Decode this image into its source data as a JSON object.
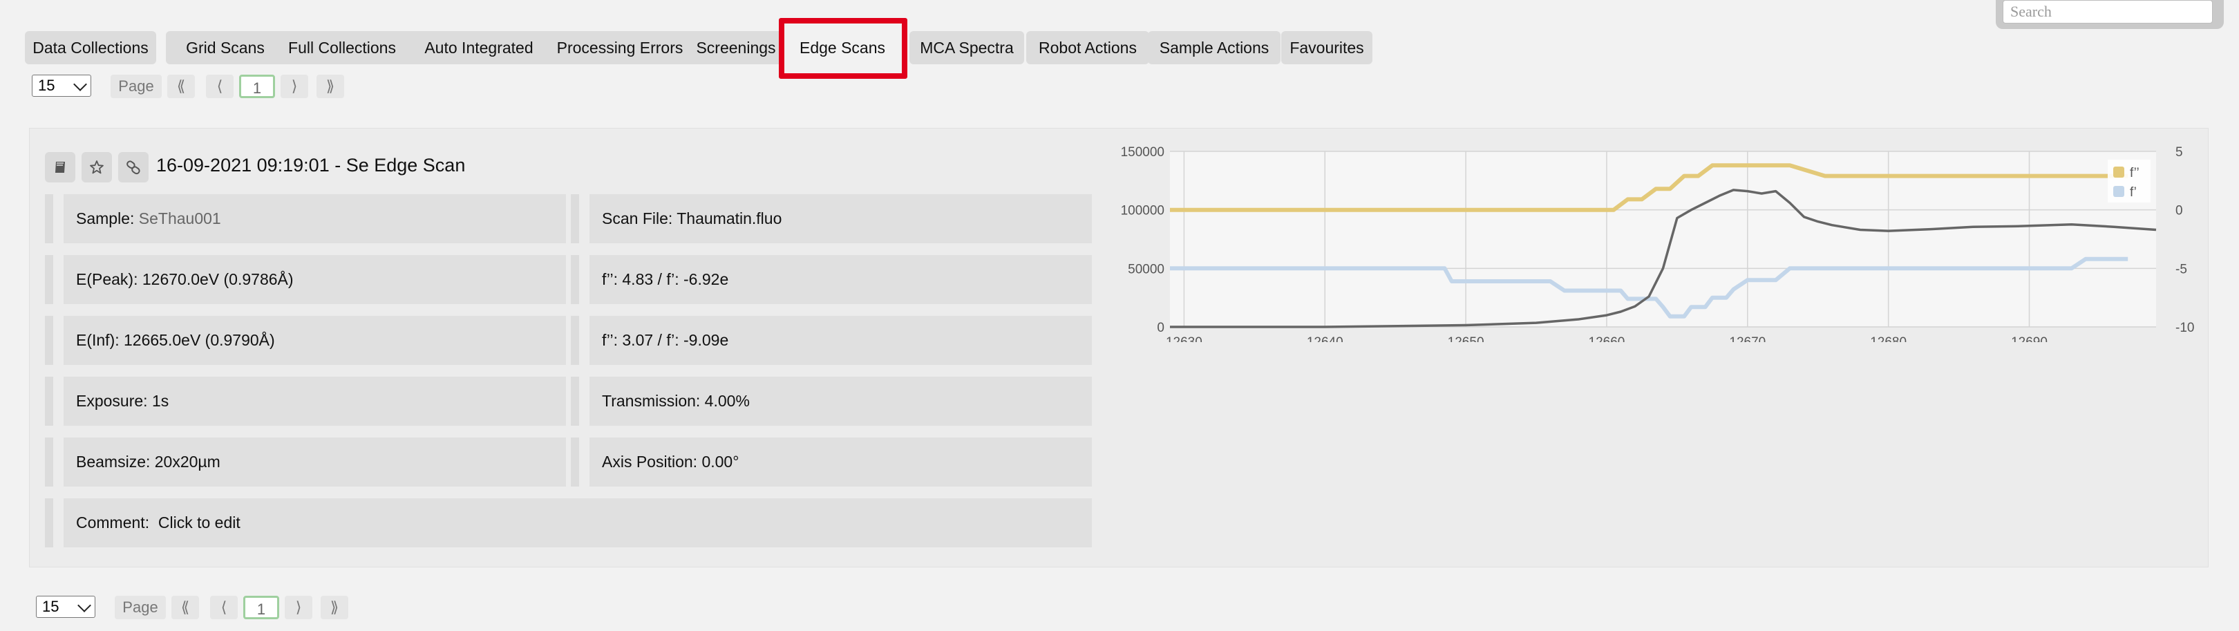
{
  "search": {
    "placeholder": "Search"
  },
  "tabs": [
    {
      "label": "Data Collections"
    },
    {
      "label": "Grid Scans"
    },
    {
      "label": "Full Collections"
    },
    {
      "label": "Auto Integrated"
    },
    {
      "label": "Processing Errors"
    },
    {
      "label": "Screenings"
    },
    {
      "label": "Edge Scans",
      "active": true
    },
    {
      "label": "MCA Spectra"
    },
    {
      "label": "Robot Actions"
    },
    {
      "label": "Sample Actions"
    },
    {
      "label": "Favourites"
    }
  ],
  "pager_top": {
    "per_page": "15",
    "page_label": "Page",
    "first": "⟪",
    "prev": "⟨",
    "current": "1",
    "next": "⟩",
    "last": "⟫"
  },
  "pager_bottom": {
    "per_page": "15",
    "page_label": "Page",
    "first": "⟪",
    "prev": "⟨",
    "current": "1",
    "next": "⟩",
    "last": "⟫"
  },
  "scan": {
    "title": "16-09-2021 09:19:01 - Se Edge Scan",
    "icons": [
      "logbook-icon",
      "star-icon",
      "link-icon"
    ],
    "sample_label": "Sample:",
    "sample_value": "SeThau001",
    "scan_file": "Scan File: Thaumatin.fluo",
    "epeak": "E(Peak): 12670.0eV (0.9786Å)",
    "fpp_peak": "f’’: 4.83 / f’: -6.92e",
    "einf": "E(Inf): 12665.0eV (0.9790Å)",
    "fpp_inf": "f’’: 3.07 / f’: -9.09e",
    "exposure": "Exposure: 1s",
    "transmission": "Transmission: 4.00%",
    "beamsize": "Beamsize: 20x20µm",
    "axis_position": "Axis Position: 0.00°",
    "comment_label": "Comment:",
    "comment_value": "Click to edit"
  },
  "chart_data": {
    "type": "line",
    "x_ticks": [
      "12630",
      "12640",
      "12650",
      "12660",
      "12670",
      "12680",
      "12690"
    ],
    "y_left_ticks": [
      "0",
      "50000",
      "100000",
      "150000"
    ],
    "y_right_ticks": [
      "-10",
      "-5",
      "0",
      "5"
    ],
    "xlim": [
      12629,
      12699
    ],
    "ylim_left": [
      0,
      150000
    ],
    "ylim_right": [
      -10,
      5
    ],
    "grid": true,
    "legend_position": "top-right",
    "colors": {
      "fpp": "#e3c979",
      "fp": "#c3d6ea",
      "counts": "#666666"
    },
    "series": [
      {
        "name": "f’’",
        "axis": "right",
        "x": [
          12629,
          12660.5,
          12661.5,
          12662.5,
          12663.5,
          12664.5,
          12665.5,
          12666.5,
          12667.5,
          12668.5,
          12673,
          12675.5,
          12697
        ],
        "values": [
          0,
          0,
          0.9,
          0.9,
          1.8,
          1.8,
          2.9,
          2.9,
          3.8,
          3.8,
          3.8,
          2.9,
          2.9
        ]
      },
      {
        "name": "f’",
        "axis": "right",
        "x": [
          12629,
          12648.5,
          12649,
          12656,
          12657,
          12661,
          12661.5,
          12663.5,
          12664,
          12664.5,
          12665.5,
          12666,
          12667,
          12667.5,
          12668.5,
          12669,
          12670,
          12672,
          12673,
          12693,
          12694,
          12697
        ],
        "values": [
          -5,
          -5,
          -6.1,
          -6.1,
          -6.9,
          -6.9,
          -7.6,
          -7.6,
          -8.3,
          -9.1,
          -9.1,
          -8.3,
          -8.3,
          -7.5,
          -7.5,
          -6.8,
          -6,
          -6,
          -5,
          -5,
          -4.2,
          -4.2
        ]
      },
      {
        "name": "",
        "axis": "left",
        "x": [
          12629,
          12640,
          12650,
          12655,
          12658,
          12660,
          12661,
          12662,
          12663,
          12664,
          12665,
          12666,
          12667,
          12668,
          12669,
          12670,
          12671,
          12672,
          12673,
          12674,
          12675,
          12676,
          12678,
          12680,
          12683,
          12686,
          12689,
          12693,
          12696,
          12699
        ],
        "values": [
          0,
          0,
          1500,
          3500,
          6500,
          10000,
          13000,
          17500,
          26000,
          50000,
          93000,
          100000,
          106000,
          112000,
          117000,
          116000,
          114000,
          116000,
          106000,
          94000,
          90000,
          87000,
          83000,
          82000,
          83500,
          85500,
          86000,
          87500,
          85500,
          83000
        ]
      }
    ]
  }
}
